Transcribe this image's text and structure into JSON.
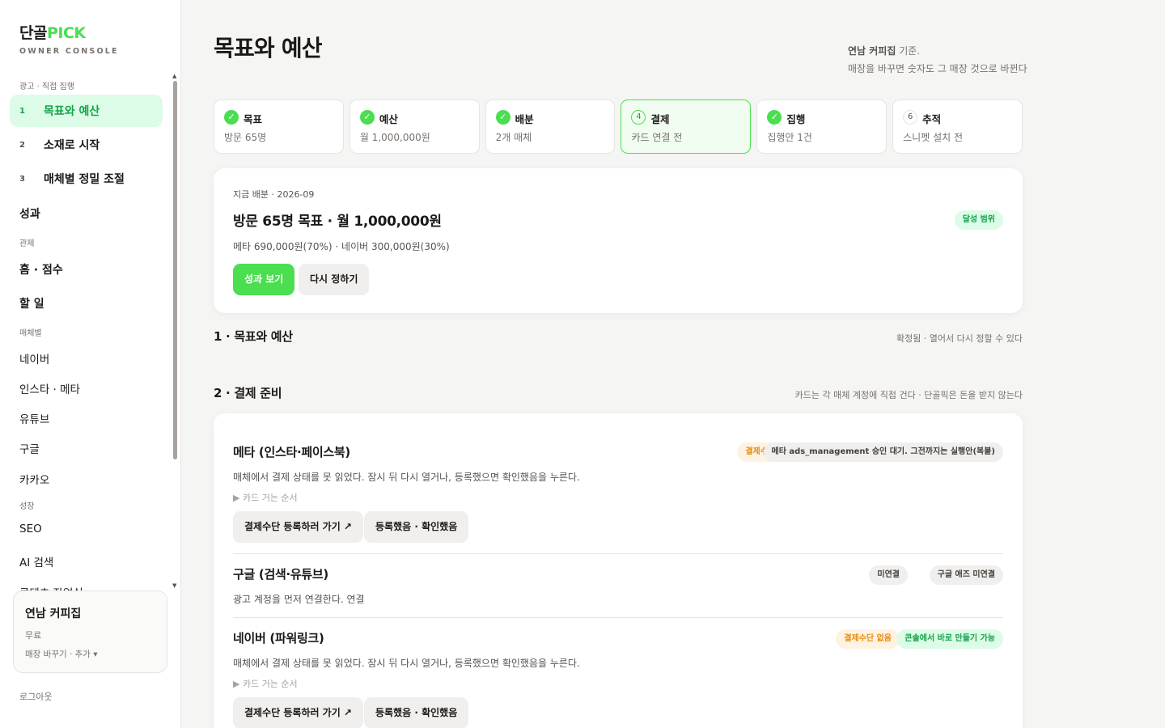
{
  "brand": {
    "name_a": "단골",
    "name_b": "PICK",
    "sub": "OWNER CONSOLE"
  },
  "sidebar": {
    "section_ads": "광고 · 직접 집행",
    "steps": [
      {
        "num": "1",
        "label": "목표와 예산"
      },
      {
        "num": "2",
        "label": "소재로 시작"
      },
      {
        "num": "3",
        "label": "매체별 정밀 조절"
      }
    ],
    "performance": "성과",
    "section_monitor": "관제",
    "home": "홈 · 점수",
    "todo": "할 일",
    "section_media": "매체별",
    "media": [
      "네이버",
      "인스타 · 메타",
      "유튜브",
      "구글",
      "카카오"
    ],
    "section_growth": "성장",
    "growth": [
      "SEO",
      "AI 검색",
      "콘텐츠 작업실"
    ],
    "store": {
      "name": "연남 커피집",
      "plan": "무료",
      "switch": "매장 바꾸기 · 추가 ▾"
    },
    "logout": "로그아웃"
  },
  "page": {
    "title": "목표와 예산",
    "note_store": "연남 커피집",
    "note_suffix": " 기준.",
    "note_line2": "매장을 바꾸면 숫자도 그 매장 것으로 바뀐다"
  },
  "steps": [
    {
      "label": "목표",
      "sub": "방문 65명",
      "state": "done"
    },
    {
      "label": "예산",
      "sub": "월 1,000,000원",
      "state": "done"
    },
    {
      "label": "배분",
      "sub": "2개 매체",
      "state": "done"
    },
    {
      "label": "결제",
      "sub": "카드 연결 전",
      "state": "current",
      "num": "4"
    },
    {
      "label": "집행",
      "sub": "집행안 1건",
      "state": "done"
    },
    {
      "label": "추적",
      "sub": "스니펫 설치 전",
      "state": "todo",
      "num": "6"
    }
  ],
  "summary": {
    "eyebrow": "지금 배분 · 2026-09",
    "title": "방문 65명 목표 · 월 1,000,000원",
    "split": "메타 690,000원(70%) · 네이버 300,000원(30%)",
    "badge": "달성 범위",
    "btn_primary": "성과 보기",
    "btn_secondary": "다시 정하기"
  },
  "section1": {
    "title": "1 · 목표와 예산",
    "note": "확정됨 · 열어서 다시 정할 수 있다"
  },
  "section2": {
    "title": "2 · 결제 준비",
    "note": "카드는 각 매체 계정에 직접 건다 · 단골픽은 돈을 받지 않는다"
  },
  "payments": [
    {
      "title": "메타 (인스타·페이스북)",
      "desc": "매체에서 결제 상태를 못 읽었다. 잠시 뒤 다시 열거나, 등록했으면 확인했음을 누른다.",
      "toggle": "▶  카드 거는 순서",
      "badges": [
        "결제수단 없음",
        "메타 ads_management 승인 대기. 그전까지는 실행안(복붙)"
      ],
      "btn_go": "결제수단 등록하러 가기 ↗",
      "btn_done": "등록했음 · 확인했음"
    },
    {
      "title": "구글 (검색·유튜브)",
      "desc": "광고 계정을 먼저 연결한다. 연결",
      "badges": [
        "미연결",
        "구글 애즈 미연결"
      ]
    },
    {
      "title": "네이버 (파워링크)",
      "desc": "매체에서 결제 상태를 못 읽었다. 잠시 뒤 다시 열거나, 등록했으면 확인했음을 누른다.",
      "toggle": "▶  카드 거는 순서",
      "badges": [
        "결제수단 없음",
        "콘솔에서 바로 만들기 가능"
      ],
      "btn_go": "결제수단 등록하러 가기 ↗",
      "btn_done": "등록했음 · 확인했음"
    }
  ],
  "colors": {
    "accent": "#4ade50",
    "accent_dark": "#16a34a",
    "warn": "#ea8a10"
  }
}
